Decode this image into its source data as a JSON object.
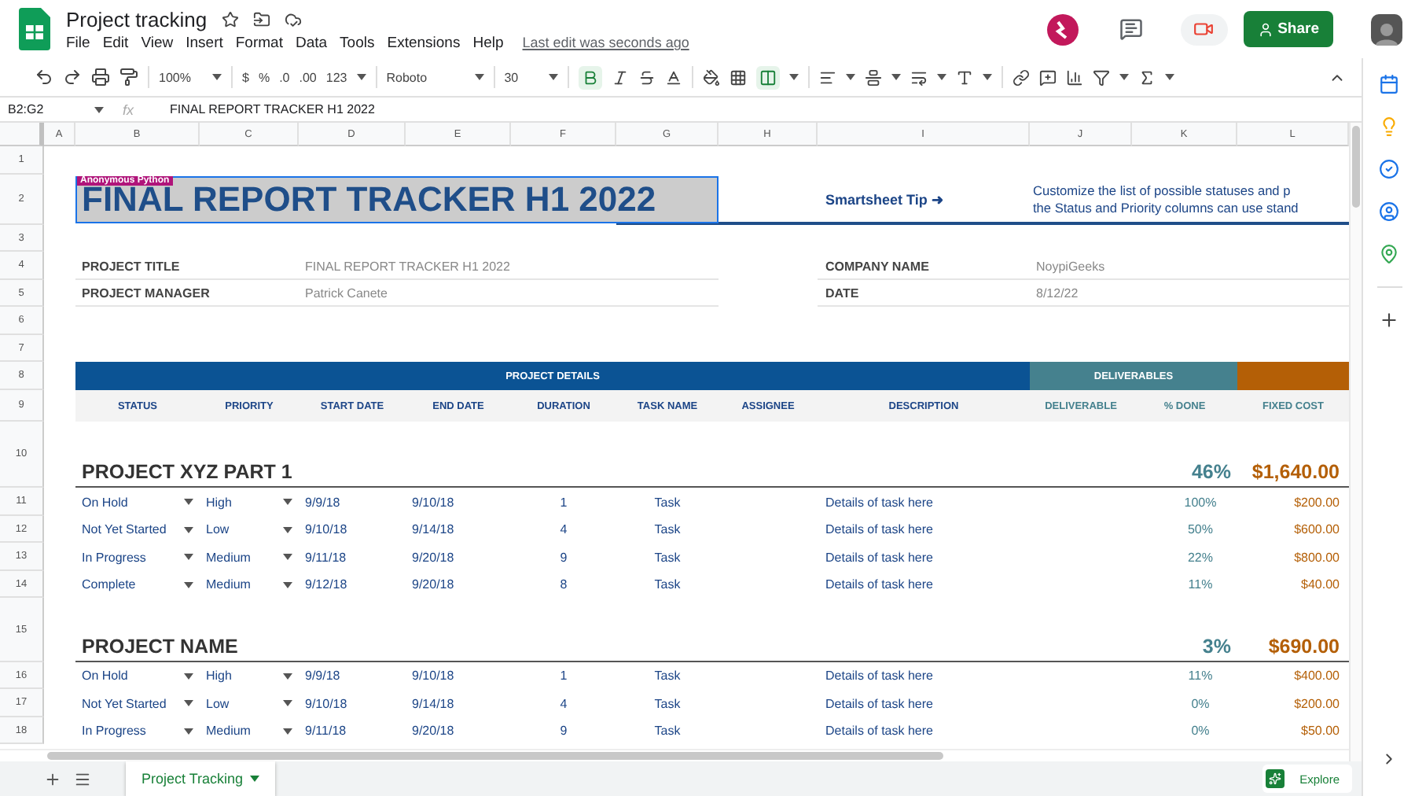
{
  "app": {
    "title": "Project tracking",
    "menu": [
      "File",
      "Edit",
      "View",
      "Insert",
      "Format",
      "Data",
      "Tools",
      "Extensions",
      "Help"
    ],
    "last_edit": "Last edit was seconds ago",
    "share": "Share"
  },
  "toolbar": {
    "zoom": "100%",
    "currency": "$",
    "percent": "%",
    "decrease_decimal": ".0",
    "increase_decimal": ".00",
    "number_format": "123",
    "font": "Roboto",
    "font_size": "30",
    "bold_on": true,
    "merge_on": true
  },
  "formula_bar": {
    "fx_label": "fx",
    "cell_ref": "B2:G2",
    "content": "FINAL REPORT TRACKER H1 2022"
  },
  "columns": [
    "A",
    "B",
    "C",
    "D",
    "E",
    "F",
    "G",
    "H",
    "I",
    "J",
    "K",
    "L"
  ],
  "rows": [
    {
      "number": "1",
      "kind": "blank"
    },
    {
      "number": "2",
      "kind": "title",
      "title": "FINAL REPORT TRACKER H1 2022",
      "selected": true,
      "tag": "Anonymous Python",
      "tip": "Smartsheet Tip ➜",
      "note": [
        "Customize the list of possible statuses and p",
        "the Status and Priority columns can use stand"
      ]
    },
    {
      "number": "3",
      "kind": "blank"
    },
    {
      "number": "4",
      "kind": "info",
      "label": "PROJECT TITLE",
      "value": "FINAL REPORT TRACKER H1 2022",
      "label_2": "COMPANY NAME",
      "value_2": "NoypiGeeks"
    },
    {
      "number": "5",
      "kind": "info",
      "label": "PROJECT MANAGER",
      "value": "Patrick Canete",
      "label_2": "DATE",
      "value_2": "8/12/22"
    },
    {
      "number": "6",
      "kind": "blank"
    },
    {
      "number": "7",
      "kind": "blank"
    },
    {
      "number": "8",
      "kind": "band",
      "sections": [
        {
          "label": "PROJECT DETAILS",
          "color": "#0b5394"
        },
        {
          "label": "DELIVERABLES",
          "color": "#45818e"
        },
        {
          "color": "#b45f06"
        }
      ]
    },
    {
      "number": "9",
      "kind": "headings",
      "cells": [
        "STATUS",
        "PRIORITY",
        "START DATE",
        "END DATE",
        "DURATION",
        "TASK NAME",
        "ASSIGNEE",
        "DESCRIPTION",
        "DELIVERABLE",
        "% DONE",
        "FIXED COST"
      ]
    },
    {
      "number": "10",
      "kind": "project",
      "name": "PROJECT XYZ PART 1",
      "done": "46%",
      "cost": "$1,640.00"
    },
    {
      "number": "11",
      "kind": "task",
      "status": "On Hold",
      "priority": "High",
      "start": "9/9/18",
      "end": "9/10/18",
      "duration": "1",
      "task": "Task",
      "description": "Details of task here",
      "done": "100%",
      "cost": "$200.00"
    },
    {
      "number": "12",
      "kind": "task",
      "status": "Not Yet Started",
      "priority": "Low",
      "start": "9/10/18",
      "end": "9/14/18",
      "duration": "4",
      "task": "Task",
      "description": "Details of task here",
      "done": "50%",
      "cost": "$600.00"
    },
    {
      "number": "13",
      "kind": "task",
      "status": "In Progress",
      "priority": "Medium",
      "start": "9/11/18",
      "end": "9/20/18",
      "duration": "9",
      "task": "Task",
      "description": "Details of task here",
      "done": "22%",
      "cost": "$800.00"
    },
    {
      "number": "14",
      "kind": "task",
      "status": "Complete",
      "priority": "Medium",
      "start": "9/12/18",
      "end": "9/20/18",
      "duration": "8",
      "task": "Task",
      "description": "Details of task here",
      "done": "11%",
      "cost": "$40.00"
    },
    {
      "number": "15",
      "kind": "project",
      "name": "PROJECT NAME",
      "done": "3%",
      "cost": "$690.00"
    },
    {
      "number": "16",
      "kind": "task",
      "status": "On Hold",
      "priority": "High",
      "start": "9/9/18",
      "end": "9/10/18",
      "duration": "1",
      "task": "Task",
      "description": "Details of task here",
      "done": "11%",
      "cost": "$400.00"
    },
    {
      "number": "17",
      "kind": "task",
      "status": "Not Yet Started",
      "priority": "Low",
      "start": "9/10/18",
      "end": "9/14/18",
      "duration": "4",
      "task": "Task",
      "description": "Details of task here",
      "done": "0%",
      "cost": "$200.00"
    },
    {
      "number": "18",
      "kind": "task",
      "status": "In Progress",
      "priority": "Medium",
      "start": "9/11/18",
      "end": "9/20/18",
      "duration": "9",
      "task": "Task",
      "description": "Details of task here",
      "done": "0%",
      "cost": "$50.00"
    }
  ],
  "tabs": [
    {
      "label": "Project Tracking",
      "selected": true
    }
  ],
  "explore": "Explore"
}
